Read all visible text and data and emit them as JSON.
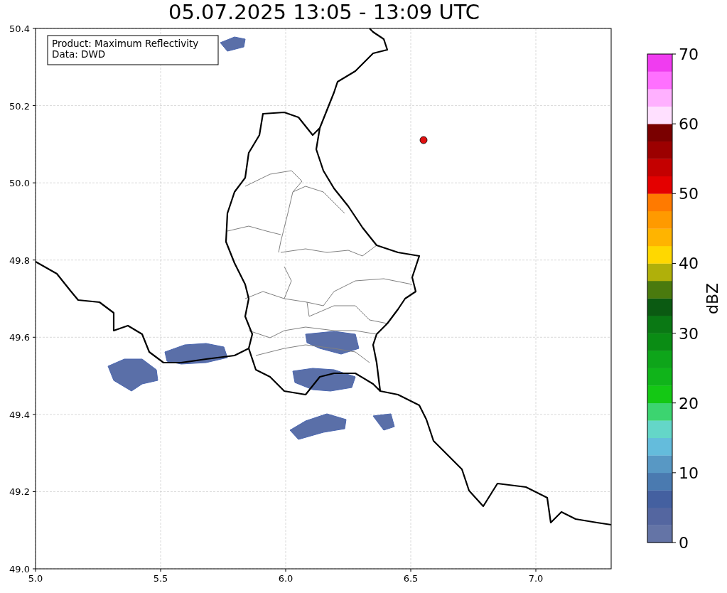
{
  "title": "05.07.2025 13:05 - 13:09 UTC",
  "legend": [
    "Product: Maximum Reflectivity",
    "Data: DWD"
  ],
  "x_axis": {
    "ticks": [
      "5.0",
      "5.5",
      "6.0",
      "6.5",
      "7.0"
    ]
  },
  "y_axis": {
    "ticks": [
      "50.4",
      "50.2",
      "50.0",
      "49.8",
      "49.6",
      "49.4",
      "49.2",
      "49.0"
    ]
  },
  "colorbar": {
    "label": "dBZ",
    "ticks": [
      "70",
      "60",
      "50",
      "40",
      "30",
      "20",
      "10",
      "0"
    ],
    "bins": [
      {
        "color": "#6474a6"
      },
      {
        "color": "#5466a0"
      },
      {
        "color": "#4460a0"
      },
      {
        "color": "#4a7ab0"
      },
      {
        "color": "#5898c4"
      },
      {
        "color": "#64bcdc"
      },
      {
        "color": "#64d6c8"
      },
      {
        "color": "#3cd470"
      },
      {
        "color": "#14c814"
      },
      {
        "color": "#10b41a"
      },
      {
        "color": "#0ea51a"
      },
      {
        "color": "#0a8c14"
      },
      {
        "color": "#0a7814"
      },
      {
        "color": "#0b5a12"
      },
      {
        "color": "#4a7a0e"
      },
      {
        "color": "#b0b00a"
      },
      {
        "color": "#ffd800"
      },
      {
        "color": "#ffb400"
      },
      {
        "color": "#ff9a00"
      },
      {
        "color": "#ff7a00"
      },
      {
        "color": "#e40000"
      },
      {
        "color": "#c40000"
      },
      {
        "color": "#9c0000"
      },
      {
        "color": "#7a0000"
      },
      {
        "color": "#ffe0ff"
      },
      {
        "color": "#ffb0ff"
      },
      {
        "color": "#ff70ff"
      },
      {
        "color": "#f03cf0"
      }
    ]
  }
}
